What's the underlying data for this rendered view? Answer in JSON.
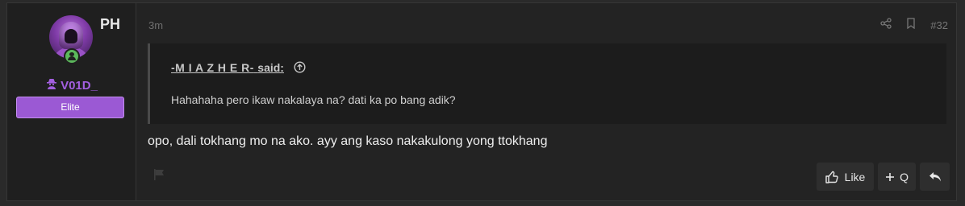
{
  "user": {
    "flag_text": "PH",
    "username": "V01D_",
    "rank": "Elite",
    "icons": {
      "avatar": "hooded-figure-avatar",
      "status": "online-user-icon",
      "name_prefix": "spy-icon"
    },
    "colors": {
      "username": "#a35fe0",
      "rank_bg": "#9b59d4",
      "online": "#5cb85c"
    }
  },
  "post": {
    "time": "3m",
    "number": "#32",
    "quote": {
      "author": "-M I A Z H E R-",
      "said": "said:",
      "text": "Hahahaha pero ikaw nakalaya na? dati ka po bang adik?"
    },
    "message": "opo, dali tokhang mo na ako. ayy ang kaso nakakulong yong ttokhang"
  },
  "actions": {
    "like_label": "Like",
    "quote_label": "Q"
  }
}
